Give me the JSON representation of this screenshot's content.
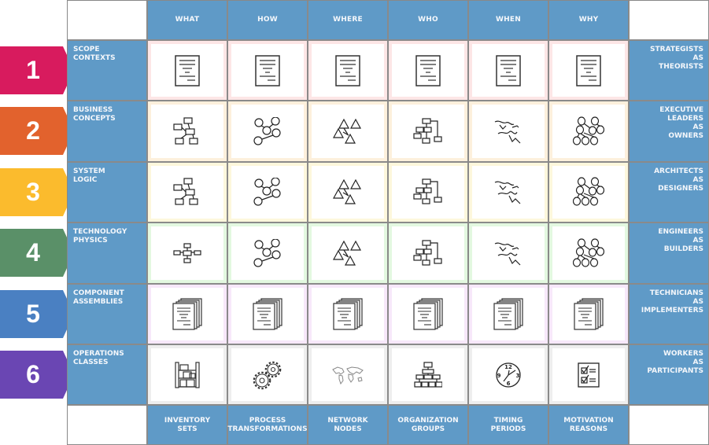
{
  "columns": [
    {
      "header": "WHAT",
      "footer": "INVENTORY\nSETS"
    },
    {
      "header": "HOW",
      "footer": "PROCESS\nTRANSFORMATIONS"
    },
    {
      "header": "WHERE",
      "footer": "NETWORK\nNODES"
    },
    {
      "header": "WHO",
      "footer": "ORGANIZATION\nGROUPS"
    },
    {
      "header": "WHEN",
      "footer": "TIMING\nPERIODS"
    },
    {
      "header": "WHY",
      "footer": "MOTIVATION\nREASONS"
    }
  ],
  "rows": [
    {
      "number": "1",
      "label": "SCOPE\nCONTEXTS",
      "perspective": "STRATEGISTS\nAS\nTHEORISTS",
      "arrow_color": "#d81b5e",
      "cell_border": "#fde6e6",
      "icons": [
        "document-icon",
        "document-icon",
        "document-icon",
        "document-icon",
        "document-icon",
        "document-icon"
      ]
    },
    {
      "number": "2",
      "label": "BUSINESS\nCONCEPTS",
      "perspective": "EXECUTIVE\nLEADERS\nAS\nOWNERS",
      "arrow_color": "#e2622d",
      "cell_border": "#fdf0dc",
      "icons": [
        "entity-diagram-icon",
        "process-graph-icon",
        "network-triangles-icon",
        "org-tree-icon",
        "timeline-sketch-icon",
        "motivation-tree-icon"
      ]
    },
    {
      "number": "3",
      "label": "SYSTEM\nLOGIC",
      "perspective": "ARCHITECTS\nAS\nDESIGNERS",
      "arrow_color": "#fbbb2d",
      "cell_border": "#fdf7dc",
      "icons": [
        "entity-diagram-icon",
        "process-graph-icon",
        "network-triangles-icon",
        "org-tree-icon",
        "timeline-sketch-icon",
        "motivation-tree-icon"
      ]
    },
    {
      "number": "4",
      "label": "TECHNOLOGY\nPHYSICS",
      "perspective": "ENGINEERS\nAS\nBUILDERS",
      "arrow_color": "#5a9068",
      "cell_border": "#e3f8e0",
      "icons": [
        "entity-cross-icon",
        "process-graph-icon",
        "network-triangles-icon",
        "org-tree-icon",
        "timeline-sketch-icon",
        "motivation-tree-icon"
      ]
    },
    {
      "number": "5",
      "label": "COMPONENT\nASSEMBLIES",
      "perspective": "TECHNICIANS\nAS\nIMPLEMENTERS",
      "arrow_color": "#4a80c2",
      "cell_border": "#f7e8fa",
      "icons": [
        "document-stack-icon",
        "document-stack-icon",
        "document-stack-icon",
        "document-stack-icon",
        "document-stack-icon",
        "document-stack-icon"
      ]
    },
    {
      "number": "6",
      "label": "OPERATIONS\nCLASSES",
      "perspective": "WORKERS\nAS\nPARTICIPANTS",
      "arrow_color": "#6a46b3",
      "cell_border": "#eeeeee",
      "icons": [
        "shelving-icon",
        "gears-icon",
        "world-map-icon",
        "hierarchy-icon",
        "clock-icon",
        "checklist-icon"
      ]
    }
  ],
  "clock": {
    "n12": "12",
    "n3": "3",
    "n6": "6",
    "n9": "9"
  },
  "colors": {
    "header_blue": "#5f9ac7",
    "grid_line": "#8a8a8a"
  }
}
